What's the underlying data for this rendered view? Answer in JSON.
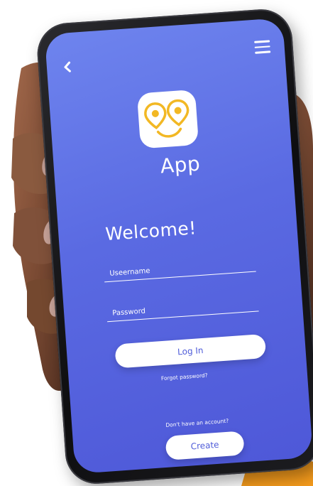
{
  "app": {
    "name": "App"
  },
  "nav": {
    "back_icon": "chevron-left-icon",
    "menu_icon": "hamburger-menu-icon"
  },
  "login": {
    "welcome": "Welcome!",
    "username_placeholder": "Useername",
    "password_placeholder": "Password",
    "login_label": "Log In",
    "forgot_label": "Forgot password?",
    "no_account_label": "Don't have an account?",
    "create_label": "Create"
  },
  "colors": {
    "screen_top": "#6e84ee",
    "screen_bottom": "#4e58d8",
    "logo_accent": "#f2b824",
    "button_text": "#4f5cd9"
  }
}
